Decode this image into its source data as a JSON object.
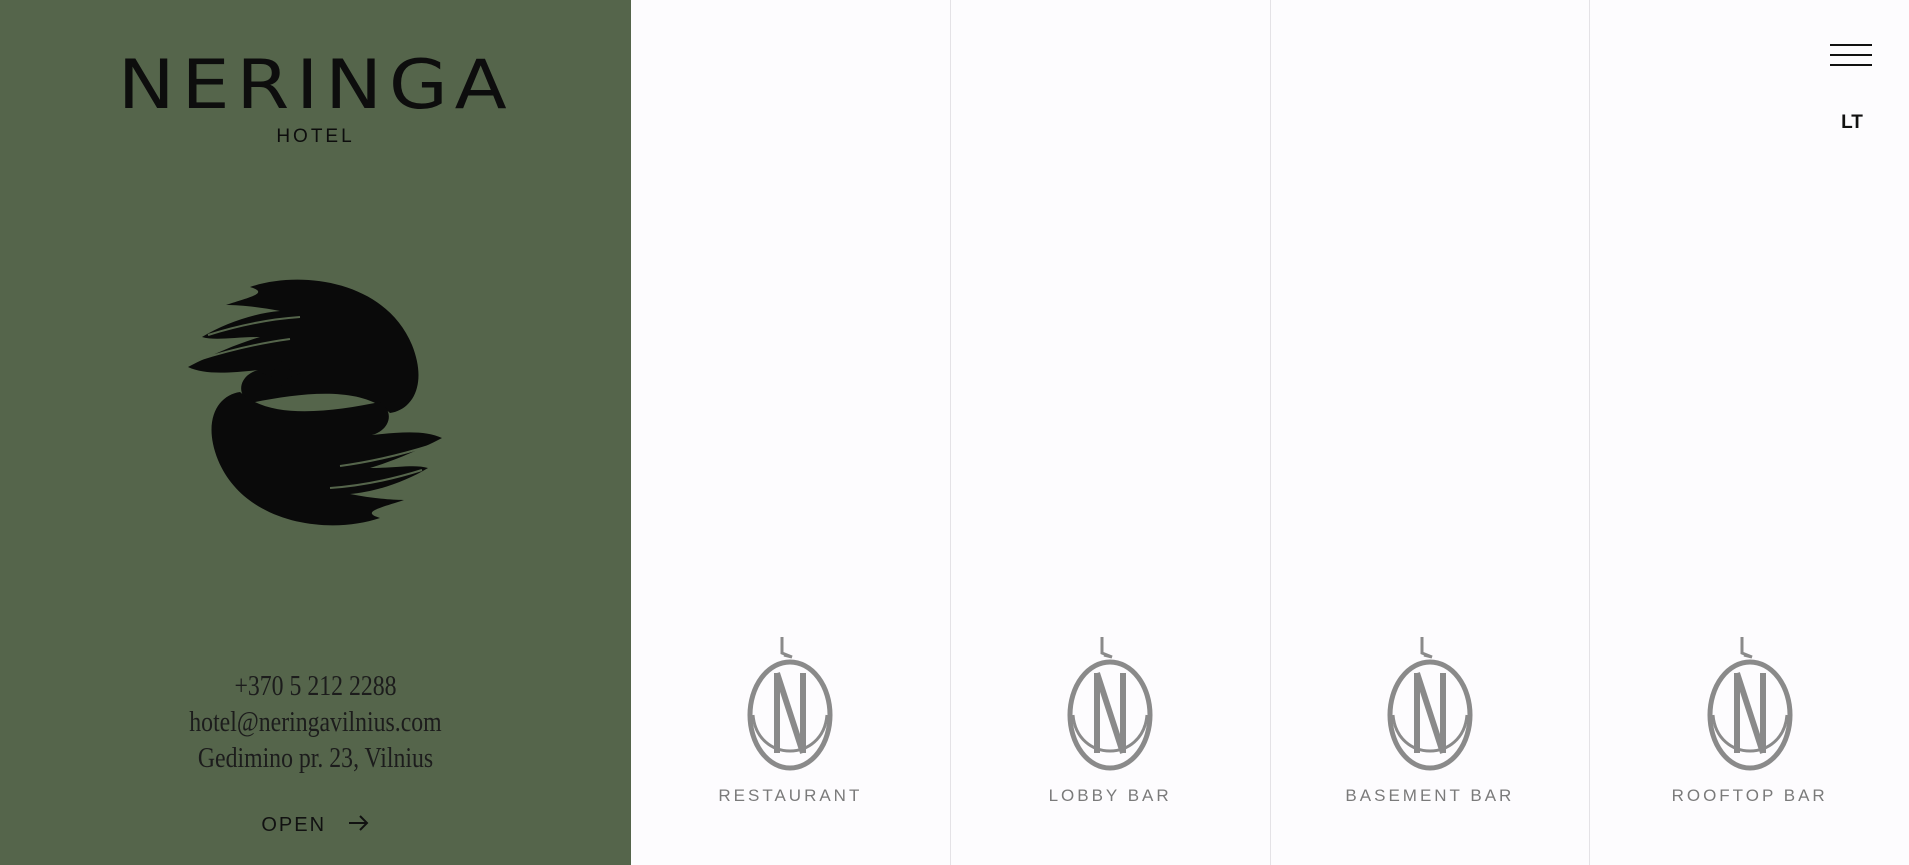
{
  "brand": {
    "name": "NERINGA",
    "subtitle": "HOTEL"
  },
  "contact": {
    "phone": "+370 5 212 2288",
    "email": "hotel@neringavilnius.com",
    "address": "Gedimino pr. 23, Vilnius"
  },
  "open_link": {
    "label": "OPEN",
    "icon": "arrow-right-icon"
  },
  "venues": [
    {
      "label": "RESTAURANT",
      "icon": "neringa-monogram-icon"
    },
    {
      "label": "LOBBY BAR",
      "icon": "neringa-monogram-icon"
    },
    {
      "label": "BASEMENT BAR",
      "icon": "neringa-monogram-icon"
    },
    {
      "label": "ROOFTOP BAR",
      "icon": "neringa-monogram-icon"
    }
  ],
  "nav": {
    "menu_icon": "hamburger-icon",
    "language": "LT"
  },
  "colors": {
    "panel": "#55654b",
    "ink": "#0d0d0d",
    "venue_label": "#7a7a7a",
    "monogram": "#8a8a8a",
    "venue_bg": "#fdfcfe"
  }
}
